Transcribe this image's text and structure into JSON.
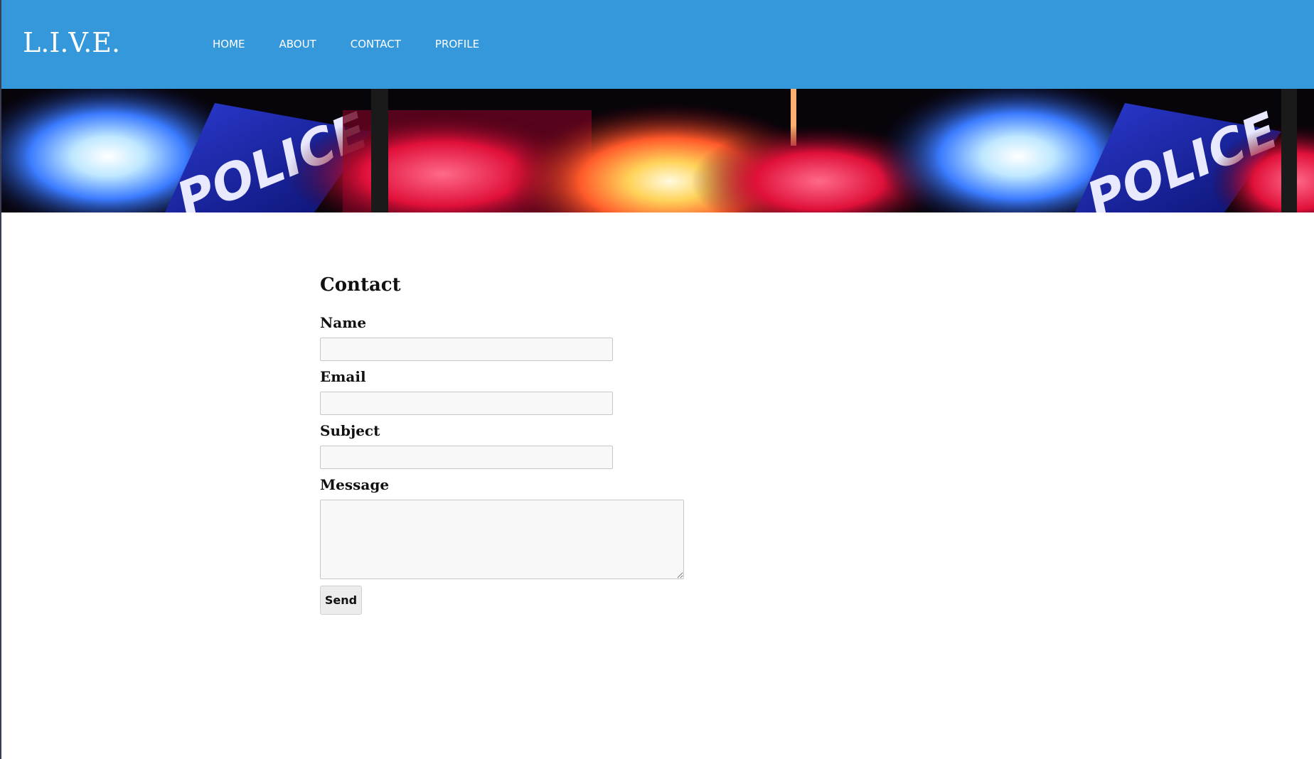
{
  "header": {
    "logo": "L.I.V.E.",
    "nav": [
      {
        "label": "HOME"
      },
      {
        "label": "ABOUT"
      },
      {
        "label": "CONTACT"
      },
      {
        "label": "PROFILE"
      }
    ],
    "background_color": "#3498db"
  },
  "banner": {
    "sign_text": "POLICE",
    "description_colors": {
      "blue": "#1a2fb0",
      "red": "#e0103a",
      "amber": "#ffd35a"
    }
  },
  "contact": {
    "title": "Contact",
    "fields": {
      "name": {
        "label": "Name",
        "value": "",
        "placeholder": ""
      },
      "email": {
        "label": "Email",
        "value": "",
        "placeholder": ""
      },
      "subject": {
        "label": "Subject",
        "value": "",
        "placeholder": ""
      },
      "message": {
        "label": "Message",
        "value": "",
        "placeholder": ""
      }
    },
    "send_label": "Send"
  }
}
